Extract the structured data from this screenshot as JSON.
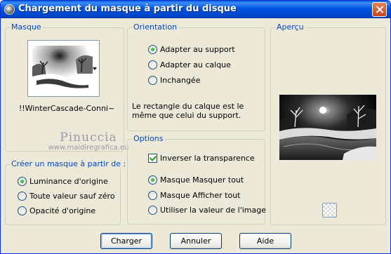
{
  "window": {
    "title": "Chargement du masque à partir du disque",
    "close_icon": "close-icon"
  },
  "masque": {
    "title": "Masque",
    "name": "!!WinterCascade-Conni~"
  },
  "watermark": {
    "line1": "Pinuccia",
    "line2": "www.maidiregrafica.eu"
  },
  "creer": {
    "title": "Créer un masque à partir de :",
    "options": [
      {
        "label": "Luminance d'origine",
        "checked": true
      },
      {
        "label": "Toute valeur sauf zéro",
        "checked": false
      },
      {
        "label": "Opacité d'origine",
        "checked": false
      }
    ]
  },
  "orientation": {
    "title": "Orientation",
    "options": [
      {
        "label": "Adapter au support",
        "checked": true
      },
      {
        "label": "Adapter au calque",
        "checked": false
      },
      {
        "label": "Inchangée",
        "checked": false
      }
    ],
    "description": "Le rectangle du calque est le même que celui du support."
  },
  "options": {
    "title": "Options",
    "inverser_label": "Inverser la transparence",
    "inverser_checked": true,
    "radios": [
      {
        "label": "Masque Masquer tout",
        "checked": true
      },
      {
        "label": "Masque Afficher tout",
        "checked": false
      },
      {
        "label": "Utiliser la valeur de l'image",
        "checked": false
      }
    ]
  },
  "apercu": {
    "title": "Aperçu"
  },
  "buttons": {
    "charger": "Charger",
    "annuler": "Annuler",
    "aide": "Aide"
  },
  "colors": {
    "titlebar": "#0054e3",
    "face": "#ece9d8",
    "group_title": "#0046d5",
    "radio_dot": "#21a121"
  }
}
